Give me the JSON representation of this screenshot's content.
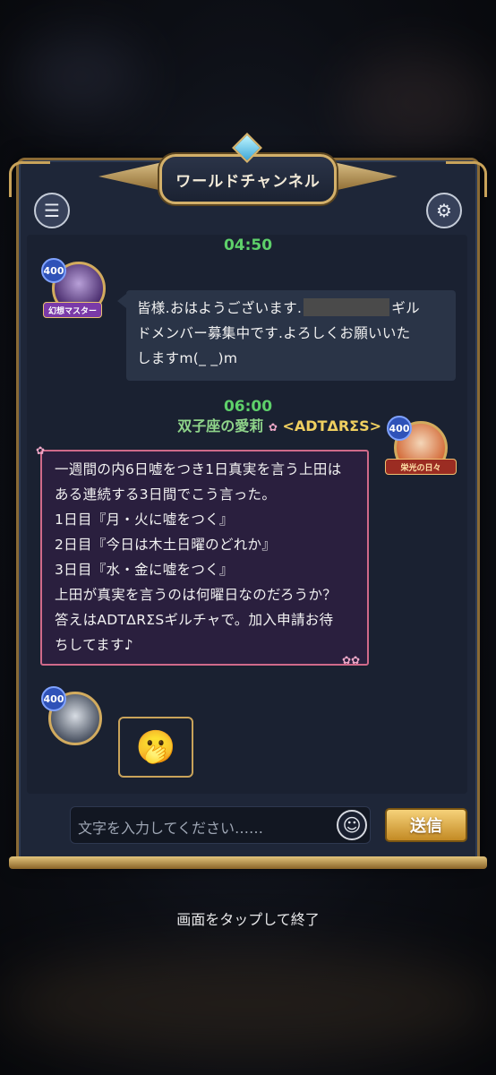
{
  "channel": {
    "title": "ワールドチャンネル"
  },
  "messages": [
    {
      "time": "04:50",
      "level": "400",
      "title_badge": "幻想マスター",
      "text_before_redaction": "皆様.おはようございます.",
      "text_after_redaction_line1": "ギル",
      "text_line2": "ドメンバー募集中です.よろしくお願いいた",
      "text_line3": "しますm(_ _)m"
    },
    {
      "time": "06:00",
      "sender_name": "双子座の愛莉",
      "sender_guild": "<ADTΔRΣS>",
      "level": "400",
      "title_badge": "栄光の日々",
      "lines": [
        "一週間の内6日嘘をつき1日真実を言う上田は",
        "ある連続する3日間でこう言った。",
        "1日目『月・火に嘘をつく』",
        "2日目『今日は木土日曜のどれか』",
        "3日目『水・金に嘘をつく』",
        "上田が真実を言うのは何曜日なのだろうか？",
        "答えはADTΔRΣSギルチャで。加入申請お待",
        "ちしてます♪"
      ]
    },
    {
      "level": "400",
      "sticker": "🫢"
    }
  ],
  "input": {
    "placeholder": "文字を入力してください……",
    "emoji_glyph": "☺",
    "send_label": "送信"
  },
  "icons": {
    "menu": "☰",
    "gear": "⚙"
  },
  "footer": {
    "exit_hint": "画面をタップして終了"
  }
}
